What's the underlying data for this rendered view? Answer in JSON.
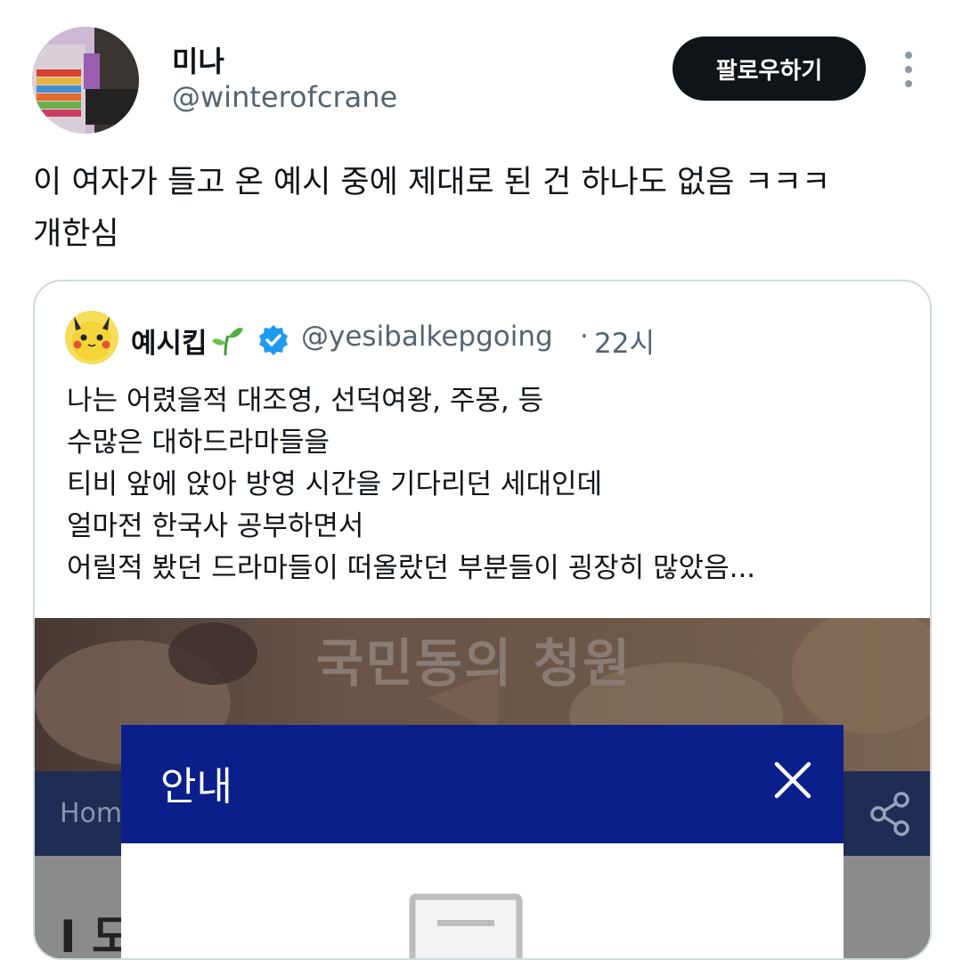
{
  "tweet": {
    "author_name": "미나",
    "author_handle": "@winterofcrane",
    "follow_label": "팔로우하기",
    "text_line1": "이 여자가 들고 온 예시 중에 제대로 된 건 하나도 없음 ㅋㅋㅋ",
    "text_line2": "개한심"
  },
  "quote": {
    "name": "예시킵",
    "handle": "@yesibalkepgoing",
    "separator": "·",
    "time": "22시",
    "lines": [
      "나는 어렸을적 대조영, 선덕여왕, 주몽, 등",
      "수많은 대하드라마들을",
      "티비 앞에 앉아 방영 시간을 기다리던 세대인데",
      "얼마전 한국사 공부하면서",
      "어릴적 봤던 드라마들이 떠올랐던 부분들이 굉장히 많았음..."
    ]
  },
  "media": {
    "banner_title": "국민동의 청원",
    "nav_home": "Hom",
    "modal_title": "안내",
    "lower_mark": "I 도"
  },
  "colors": {
    "follow_bg": "#0f1419",
    "secondary_text": "#536471",
    "verified": "#1d9bf0",
    "modal_header": "#0b1f8a",
    "navbar": "#1f2d55"
  },
  "icons": [
    "more-vertical-icon",
    "sprout-icon",
    "verified-badge-icon",
    "share-icon",
    "close-icon",
    "document-icon"
  ]
}
